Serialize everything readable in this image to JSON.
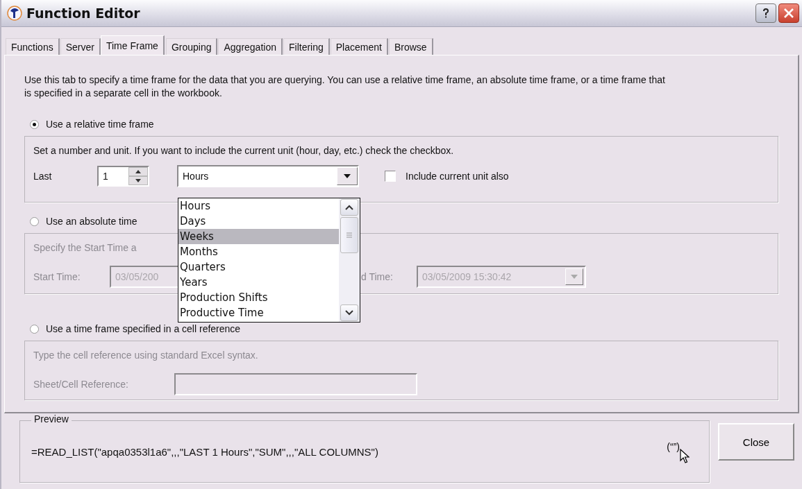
{
  "window": {
    "title": "Function Editor"
  },
  "tabs": [
    {
      "label": "Functions",
      "selected": false
    },
    {
      "label": "Server",
      "selected": false
    },
    {
      "label": "Time Frame",
      "selected": true
    },
    {
      "label": "Grouping",
      "selected": false
    },
    {
      "label": "Aggregation",
      "selected": false
    },
    {
      "label": "Filtering",
      "selected": false
    },
    {
      "label": "Placement",
      "selected": false
    },
    {
      "label": "Browse",
      "selected": false
    }
  ],
  "description": "Use this tab to specify a time frame for the data that you are querying. You can use a relative time frame, an absolute time frame, or a time frame that is specified in a separate cell in the workbook.",
  "options": [
    {
      "label": "Use a relative time frame",
      "selected": true
    },
    {
      "label": "Use an absolute time",
      "selected": false
    },
    {
      "label": "Use a time frame specified in a cell reference",
      "selected": false
    }
  ],
  "relative": {
    "hint": "Set a number and unit. If you want to include the current unit (hour, day, etc.) check the checkbox.",
    "last_label": "Last",
    "number": "1",
    "unit": "Hours",
    "include_current": {
      "label": "Include current unit also",
      "checked": false
    },
    "unit_list": [
      {
        "label": "Hours",
        "selected": false
      },
      {
        "label": "Days",
        "selected": false
      },
      {
        "label": "Weeks",
        "selected": true
      },
      {
        "label": "Months",
        "selected": false
      },
      {
        "label": "Quarters",
        "selected": false
      },
      {
        "label": "Years",
        "selected": false
      },
      {
        "label": "Production Shifts",
        "selected": false
      },
      {
        "label": "Productive Time",
        "selected": false
      }
    ]
  },
  "absolute": {
    "disabled": true,
    "hint": "Specify the Start Time a",
    "start_label": "Start Time:",
    "start_value": "03/05/200",
    "end_label": "d Time:",
    "end_value": "03/05/2009 15:30:42"
  },
  "cell": {
    "disabled": true,
    "hint": "Type the cell reference using standard Excel syntax.",
    "label": "Sheet/Cell Reference:"
  },
  "preview": {
    "title": "Preview",
    "formula": "=READ_LIST(\"apqa0353l1a6\",,,\"LAST 1 Hours\",\"SUM\",,,\"ALL COLUMNS\")",
    "quote_button": "(“”)"
  },
  "buttons": [
    "Close"
  ]
}
